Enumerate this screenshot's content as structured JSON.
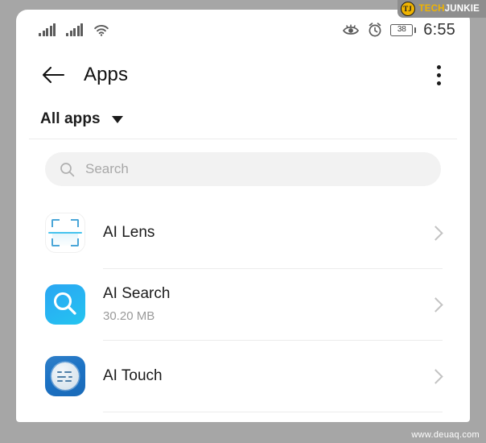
{
  "watermarks": {
    "brand_initials": "TJ",
    "brand_part1": "TECH",
    "brand_part2": "JUNKIE",
    "site": "www.deuaq.com"
  },
  "status_bar": {
    "signal_icon_1": "signal-bars-icon",
    "signal_icon_2": "signal-bars-icon",
    "wifi_icon": "wifi-icon",
    "eye_comfort_icon": "eye-comfort-icon",
    "alarm_icon": "alarm-clock-icon",
    "battery_level": "38",
    "time": "6:55"
  },
  "title_bar": {
    "back_icon": "back-arrow-icon",
    "title": "Apps",
    "overflow_icon": "more-vertical-icon"
  },
  "filter": {
    "label": "All apps",
    "caret_icon": "chevron-down-icon"
  },
  "search": {
    "icon": "search-icon",
    "placeholder": "Search",
    "value": ""
  },
  "apps": [
    {
      "name": "AI Lens",
      "size": "",
      "icon": "ai-lens-icon",
      "chevron_icon": "chevron-right-icon"
    },
    {
      "name": "AI Search",
      "size": "30.20 MB",
      "icon": "ai-search-icon",
      "chevron_icon": "chevron-right-icon"
    },
    {
      "name": "AI Touch",
      "size": "",
      "icon": "ai-touch-icon",
      "chevron_icon": "chevron-right-icon"
    }
  ],
  "colors": {
    "frame": "#a6a6a6",
    "accent_blue": "#27b6f2",
    "touch_blue": "#1c72c4",
    "text_primary": "#1b1b1b",
    "text_secondary": "#9a9a9a",
    "brand_gold": "#f0b400"
  }
}
